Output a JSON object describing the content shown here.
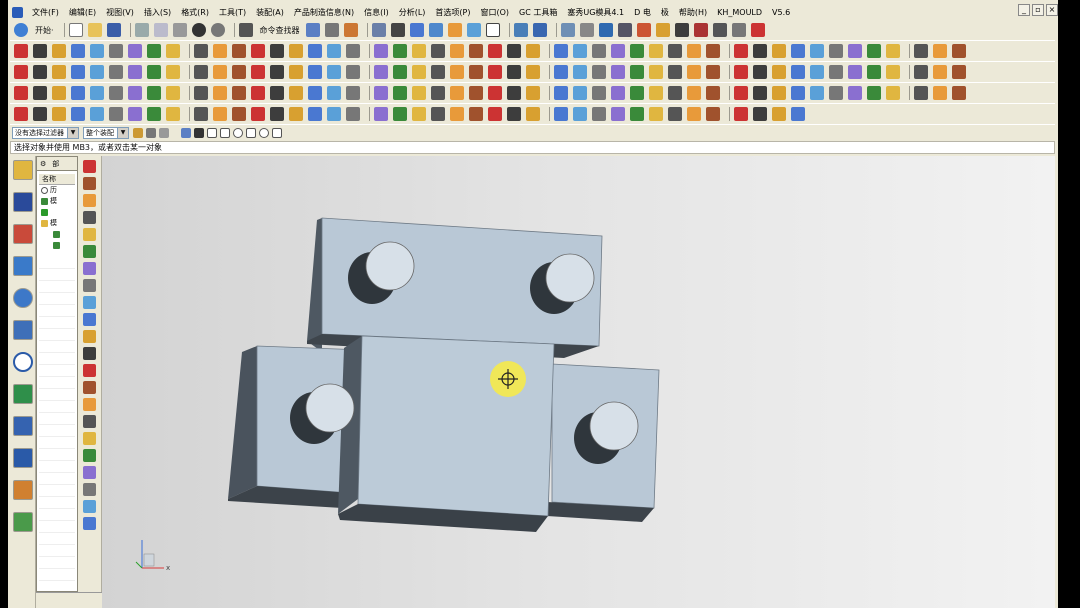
{
  "menubar": {
    "items": [
      "文件(F)",
      "编辑(E)",
      "视图(V)",
      "插入(S)",
      "格式(R)",
      "工具(T)",
      "装配(A)",
      "产品制造信息(N)",
      "信息(I)",
      "分析(L)",
      "首选项(P)",
      "窗口(O)",
      "GC 工具箱",
      "塞秀UG模具4.1",
      "D 电",
      "极",
      "帮助(H)",
      "KH_MOULD",
      "V5.6"
    ]
  },
  "toolbar1": {
    "start_label": "开始·",
    "command_finder_label": "命令查找器"
  },
  "filterbar": {
    "type_filter": "没有选择过滤器",
    "scope_filter": "整个装配"
  },
  "cue_line": {
    "text": "选择对象并使用 MB3，或者双击某一对象"
  },
  "navigator": {
    "tabs": [
      "部"
    ],
    "column_header": "名称",
    "rows": [
      "历",
      "模",
      "",
      "",
      "模"
    ]
  },
  "icons": {
    "app": "nx-logo-icon",
    "work_cursor": "rotate-cursor-icon",
    "triad": "wcs-triad-icon"
  },
  "colors": {
    "part_face": "#b9c8d6",
    "part_dark": "#4e5862",
    "highlight": "#f5ea4a",
    "background_top": "#d3d3d3"
  }
}
